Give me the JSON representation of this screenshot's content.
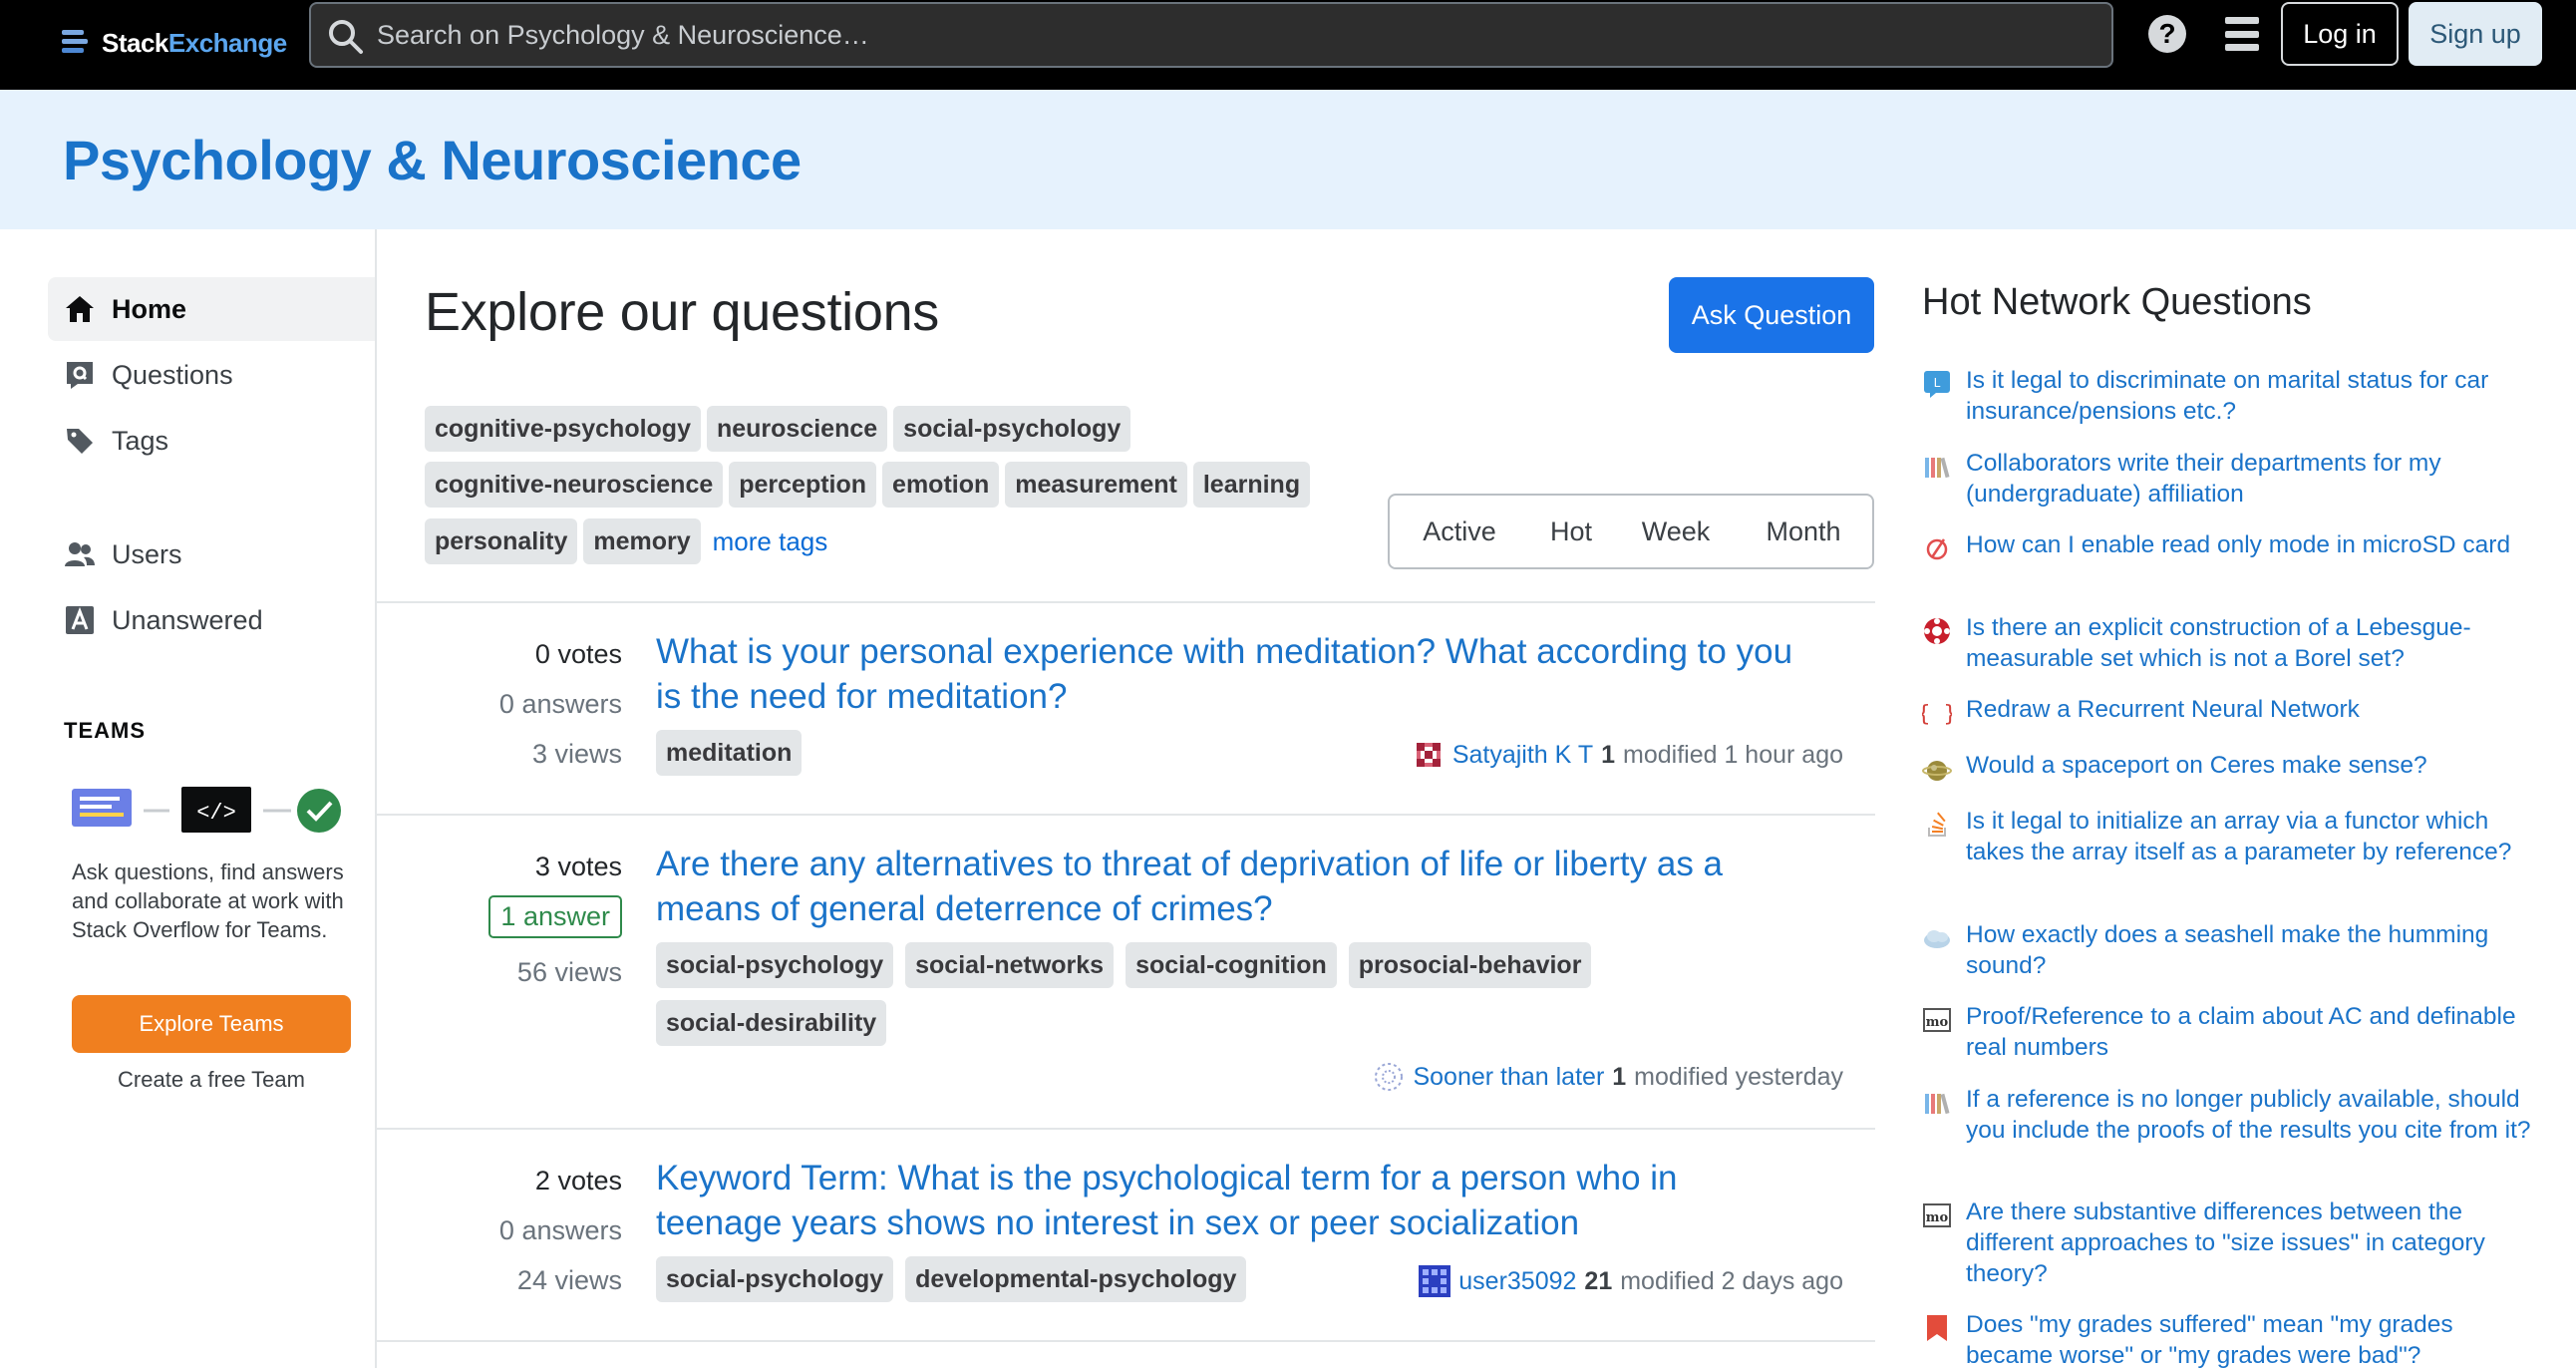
{
  "topbar": {
    "logo_word1": "Stack",
    "logo_word2": "Exchange",
    "search_placeholder": "Search on Psychology & Neuroscience…",
    "help_label": "?",
    "login_label": "Log in",
    "signup_label": "Sign up"
  },
  "site": {
    "title": "Psychology & Neuroscience"
  },
  "leftnav": {
    "items": [
      {
        "label": "Home",
        "icon": "home-icon"
      },
      {
        "label": "Questions",
        "icon": "questions-icon"
      },
      {
        "label": "Tags",
        "icon": "tag-icon"
      },
      {
        "label": "Users",
        "icon": "users-icon"
      },
      {
        "label": "Unanswered",
        "icon": "unanswered-icon"
      }
    ],
    "teams_heading": "TEAMS",
    "teams_text": "Ask questions, find answers and collaborate at work with Stack Overflow for Teams.",
    "explore_label": "Explore Teams",
    "create_label": "Create a free Team"
  },
  "main": {
    "title": "Explore our questions",
    "ask_label": "Ask Question",
    "tags_row1": [
      "cognitive-psychology",
      "neuroscience",
      "social-psychology"
    ],
    "tags_row2": [
      "cognitive-neuroscience",
      "perception",
      "emotion",
      "measurement",
      "learning"
    ],
    "tags_row3": [
      "personality",
      "memory"
    ],
    "more_tags": "more tags",
    "tabs": [
      "Active",
      "Hot",
      "Week",
      "Month"
    ],
    "questions": [
      {
        "votes": "0",
        "votes_label": "votes",
        "answers": "0",
        "answers_label": "answers",
        "views": "3",
        "views_label": "views",
        "title": "What is your personal experience with meditation? What according to you is the need for meditation?",
        "tags": [
          "meditation"
        ],
        "user": "Satyajith K T",
        "rep": "1",
        "modified": "modified 1 hour ago"
      },
      {
        "votes": "3",
        "votes_label": "votes",
        "answers": "1",
        "answers_label": "answer",
        "views": "56",
        "views_label": "views",
        "title": "Are there any alternatives to threat of deprivation of life or liberty as a means of general deterrence of crimes?",
        "tags": [
          "social-psychology",
          "social-networks",
          "social-cognition",
          "prosocial-behavior",
          "social-desirability"
        ],
        "user": "Sooner than later",
        "rep": "1",
        "modified": "modified yesterday"
      },
      {
        "votes": "2",
        "votes_label": "votes",
        "answers": "0",
        "answers_label": "answers",
        "views": "24",
        "views_label": "views",
        "title": "Keyword Term: What is the psychological term for a person who in teenage years shows no interest in sex or peer socialization",
        "tags": [
          "social-psychology",
          "developmental-psychology"
        ],
        "user": "user35092",
        "rep": "21",
        "modified": "modified 2 days ago"
      }
    ]
  },
  "hnq": {
    "title": "Hot Network Questions",
    "items": [
      {
        "text": "Is it legal to discriminate on marital status for car insurance/pensions etc.?",
        "icon": "law-site-icon"
      },
      {
        "text": "Collaborators write their departments for my (undergraduate) affiliation",
        "icon": "academia-site-icon"
      },
      {
        "text": "How can I enable read only mode in microSD card",
        "icon": "superuser-site-icon"
      },
      {
        "text": "Is there an explicit construction of a Lebesgue-measurable set which is not a Borel set?",
        "icon": "math-site-icon"
      },
      {
        "text": "Redraw a Recurrent Neural Network",
        "icon": "tex-site-icon"
      },
      {
        "text": "Would a spaceport on Ceres make sense?",
        "icon": "worldbuilding-site-icon"
      },
      {
        "text": "Is it legal to initialize an array via a functor which takes the array itself as a parameter by reference?",
        "icon": "stackoverflow-site-icon"
      },
      {
        "text": "How exactly does a seashell make the humming sound?",
        "icon": "physics-site-icon"
      },
      {
        "text": "Proof/Reference to a claim about AC and definable real numbers",
        "icon": "mathoverflow-site-icon"
      },
      {
        "text": "If a reference is no longer publicly available, should you include the proofs of the results you cite from it?",
        "icon": "academia-site-icon"
      },
      {
        "text": "Are there substantive differences between the different approaches to \"size issues\" in category theory?",
        "icon": "mathoverflow-site-icon"
      },
      {
        "text": "Does \"my grades suffered\" mean \"my grades became worse\" or \"my grades were bad\"?",
        "icon": "ell-site-icon"
      }
    ]
  },
  "colors": {
    "accent": "#1a73c9",
    "ask_button": "#1a73e8",
    "explore_button": "#f07f1f",
    "banner": "#e6f2fd"
  }
}
